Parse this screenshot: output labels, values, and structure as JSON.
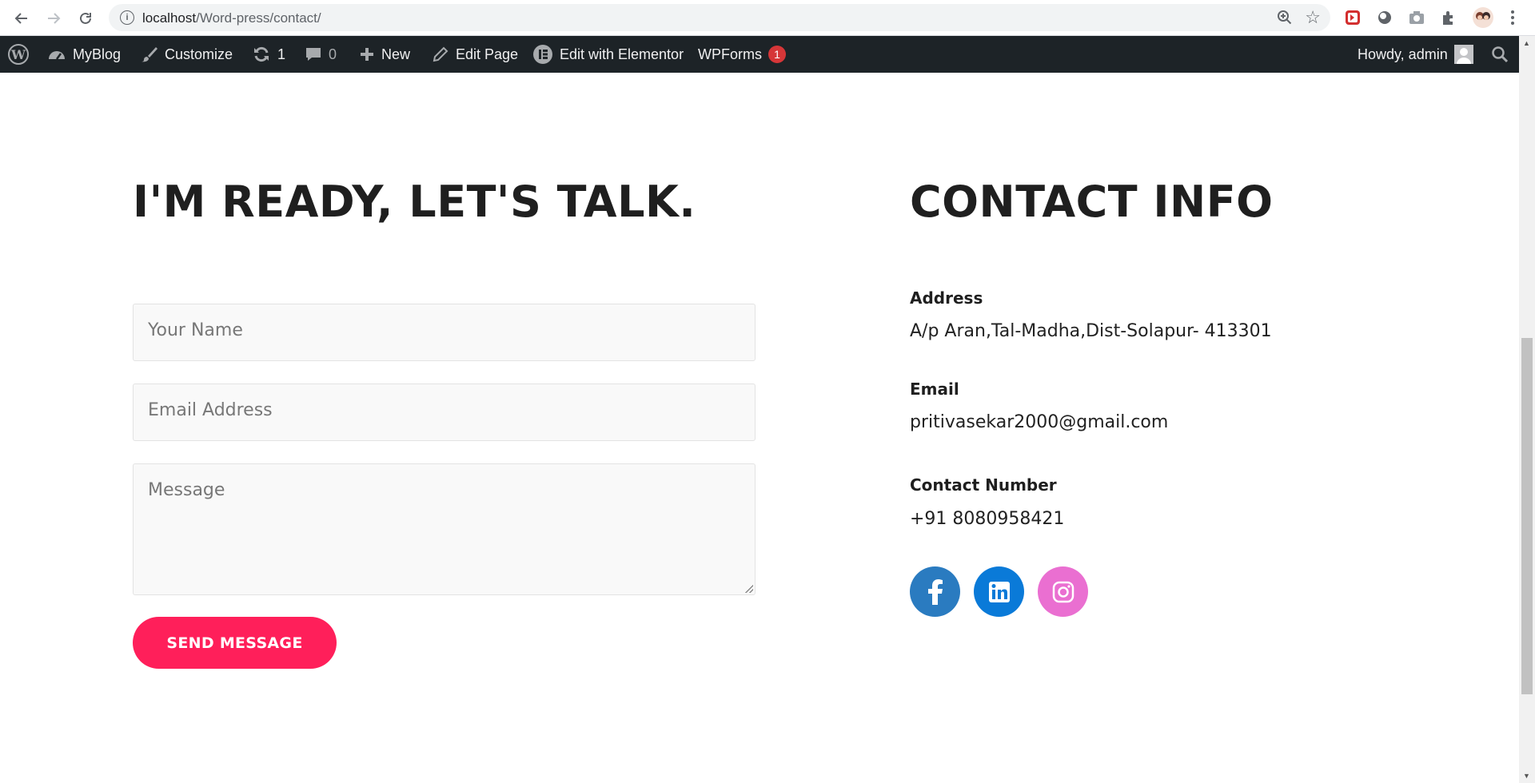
{
  "browser": {
    "url_host": "localhost",
    "url_path": "/Word-press/contact/"
  },
  "adminbar": {
    "site_name": "MyBlog",
    "customize": "Customize",
    "updates_count": "1",
    "comments_count": "0",
    "new": "New",
    "edit_page": "Edit Page",
    "edit_elementor": "Edit with Elementor",
    "wpforms": "WPForms",
    "wpforms_badge": "1",
    "howdy": "Howdy, admin"
  },
  "form": {
    "heading": "I'M READY, LET'S TALK.",
    "name_placeholder": "Your Name",
    "email_placeholder": "Email Address",
    "message_placeholder": "Message",
    "send_label": "SEND MESSAGE"
  },
  "contact": {
    "heading": "CONTACT INFO",
    "address_label": "Address",
    "address_value": "A/p Aran,Tal-Madha,Dist-Solapur- 413301",
    "email_label": "Email",
    "email_value": "pritivasekar2000@gmail.com",
    "phone_label": "Contact Number",
    "phone_value": "+91 8080958421"
  },
  "social": [
    {
      "name": "facebook",
      "color": "#2a7bc0"
    },
    {
      "name": "linkedin",
      "color": "#0a7ad8"
    },
    {
      "name": "instagram",
      "color": "#ea6fd1"
    }
  ],
  "colors": {
    "accent": "#ff1f5a",
    "adminbar": "#1d2327"
  }
}
